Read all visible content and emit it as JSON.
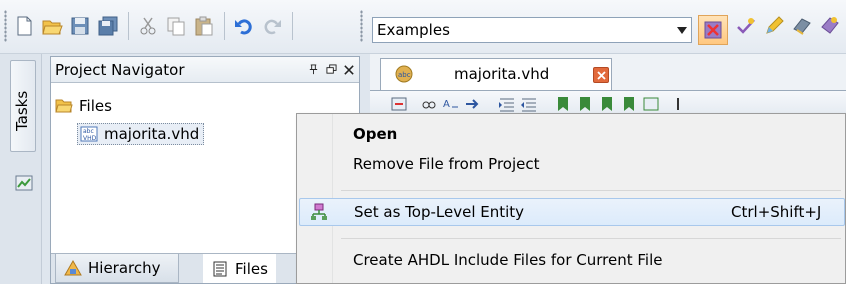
{
  "toolbar": {
    "config_combo": {
      "value": "Examples"
    }
  },
  "side": {
    "tasks_label": "Tasks"
  },
  "project_navigator": {
    "title": "Project Navigator",
    "tree": {
      "folder_label": "Files",
      "file_label": "majorita.vhd"
    },
    "bottom_tabs": [
      {
        "label": "Hierarchy"
      },
      {
        "label": "Files"
      }
    ]
  },
  "editor": {
    "tab_label": "majorita.vhd"
  },
  "context_menu": {
    "items": [
      {
        "label": "Open"
      },
      {
        "label": "Remove File from Project"
      },
      {
        "label": "Set as Top-Level Entity",
        "shortcut": "Ctrl+Shift+J"
      },
      {
        "label": "Create AHDL Include Files for Current File"
      }
    ]
  }
}
